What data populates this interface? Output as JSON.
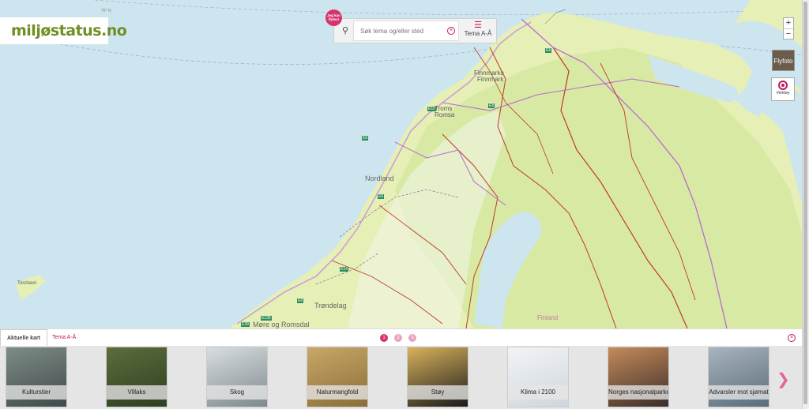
{
  "logo": {
    "text": "miljøstatus.no"
  },
  "flight_badge": {
    "line1": "Jeg kan",
    "line2": "flytes!"
  },
  "search": {
    "placeholder": "Søk tema og/eller sted",
    "menu_label": "Tema A-Å"
  },
  "zoom": {
    "in": "+",
    "out": "−"
  },
  "layer_toggle": {
    "label": "Flyfoto"
  },
  "tools": {
    "label": "Verktøy"
  },
  "map_labels": [
    {
      "text": "Finnmarku"
    },
    {
      "text": "Finnmark"
    },
    {
      "text": "Troms"
    },
    {
      "text": "Romsa"
    },
    {
      "text": "Nordland"
    },
    {
      "text": "Trøndelag"
    },
    {
      "text": "Møre og Romsdal"
    },
    {
      "text": "Finland"
    },
    {
      "text": "Torshavn"
    },
    {
      "text": "70° N"
    }
  ],
  "route_badges": [
    "E6",
    "E8",
    "E10",
    "E6",
    "E6",
    "E14",
    "E6",
    "E136",
    "E39"
  ],
  "bottom_tabs": {
    "active": "Aktuelle kart",
    "other": "Tema A-Å"
  },
  "pagination": [
    "1",
    "2",
    "3"
  ],
  "cards": [
    {
      "label": "Kulturstier",
      "color1": "#3f4b4a",
      "color2": "#7e8c87"
    },
    {
      "label": "Villaks",
      "color1": "#2f3e22",
      "color2": "#5b6e3b"
    },
    {
      "label": "Skog",
      "color1": "#7e8a8c",
      "color2": "#d8dde0"
    },
    {
      "label": "Naturmangfold",
      "color1": "#8a6d3a",
      "color2": "#c9a866"
    },
    {
      "label": "Støy",
      "color1": "#1b1b1b",
      "color2": "#d9b25c"
    },
    {
      "label": "Klima i 2100",
      "color1": "#cfd6dc",
      "color2": "#f2f4f6"
    },
    {
      "label": "Norges nasjonalparker",
      "color1": "#3b2e2a",
      "color2": "#c58b5a"
    },
    {
      "label": "Advarsler mot sjømat",
      "color1": "#5c6c7a",
      "color2": "#a8b4bf"
    }
  ],
  "colors": {
    "accent": "#c2185b",
    "sea": "#c9e3ee",
    "land": "#e8f0b8",
    "forest": "#d5e8a0",
    "border": "#c0392b",
    "county": "#b76ccf"
  }
}
